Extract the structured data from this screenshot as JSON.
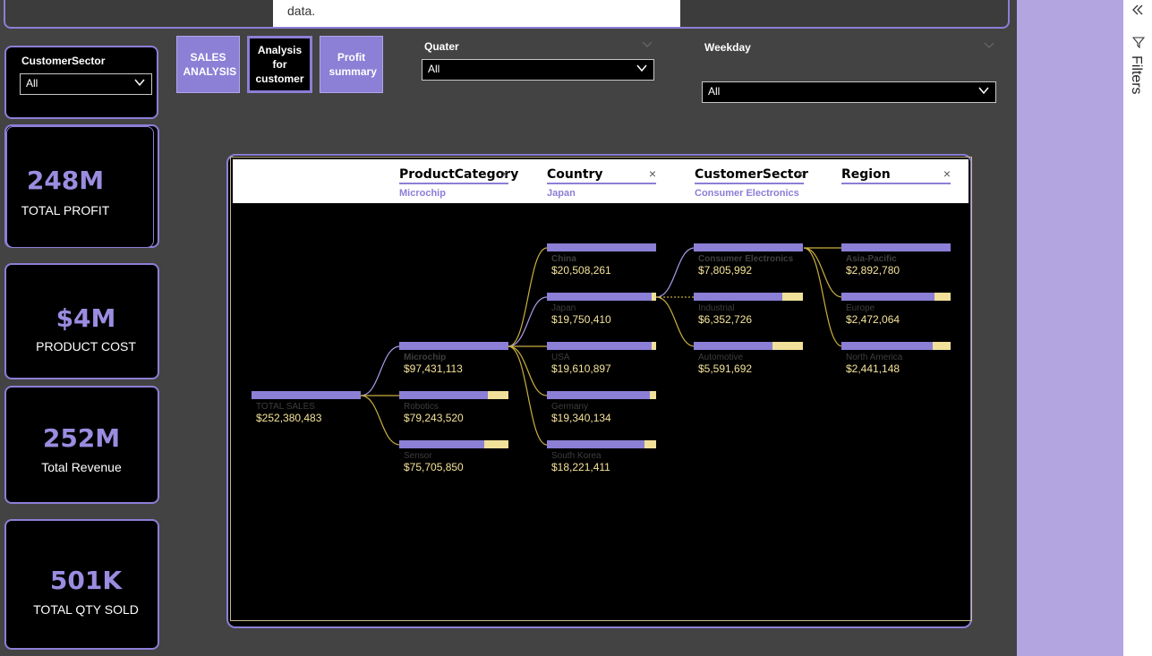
{
  "tooltip": {
    "text": "data."
  },
  "slicers": {
    "customer_sector": {
      "title": "CustomerSector",
      "value": "All"
    },
    "quarter": {
      "title": "Quater",
      "value": "All"
    },
    "weekday": {
      "title": "Weekday",
      "value": "All"
    }
  },
  "nav": {
    "sales": "SALES ANALYSIS",
    "customer": "Analysis for customer",
    "profit": "Profit summary"
  },
  "kpis": [
    {
      "value": "248M",
      "label": "TOTAL PROFIT"
    },
    {
      "value": "$4M",
      "label": "PRODUCT COST"
    },
    {
      "value": "252M",
      "label": "Total Revenue"
    },
    {
      "value": "501K",
      "label": "TOTAL QTY SOLD"
    }
  ],
  "tree": {
    "levels": [
      {
        "title": "ProductCategory",
        "selected": "Microchip",
        "close": "×"
      },
      {
        "title": "Country",
        "selected": "Japan",
        "close": "×"
      },
      {
        "title": "CustomerSector",
        "selected": "Consumer Electronics",
        "close": "×"
      },
      {
        "title": "Region",
        "selected": "",
        "close": "×"
      }
    ],
    "root": {
      "label": "TOTAL SALES",
      "value": "$252,380,483",
      "fill": 1.0
    },
    "product_category": [
      {
        "label": "Microchip",
        "value": "$97,431,113",
        "fill": 1.0
      },
      {
        "label": "Robotics",
        "value": "$79,243,520",
        "fill": 0.81
      },
      {
        "label": "Sensor",
        "value": "$75,705,850",
        "fill": 0.78
      }
    ],
    "country": [
      {
        "label": "China",
        "value": "$20,508,261",
        "fill": 1.0
      },
      {
        "label": "Japan",
        "value": "$19,750,410",
        "fill": 0.96
      },
      {
        "label": "USA",
        "value": "$19,610,897",
        "fill": 0.96
      },
      {
        "label": "Germany",
        "value": "$19,340,134",
        "fill": 0.94
      },
      {
        "label": "South Korea",
        "value": "$18,221,411",
        "fill": 0.89
      }
    ],
    "customer_sector": [
      {
        "label": "Consumer Electronics",
        "value": "$7,805,992",
        "fill": 1.0
      },
      {
        "label": "Industrial",
        "value": "$6,352,726",
        "fill": 0.81
      },
      {
        "label": "Automotive",
        "value": "$5,591,692",
        "fill": 0.72
      }
    ],
    "region": [
      {
        "label": "Asia-Pacific",
        "value": "$2,892,780",
        "fill": 1.0
      },
      {
        "label": "Europe",
        "value": "$2,472,064",
        "fill": 0.85
      },
      {
        "label": "North America",
        "value": "$2,441,148",
        "fill": 0.84
      }
    ]
  },
  "filters_pane": {
    "label": "Filters"
  },
  "colors": {
    "accent": "#8b7fd6",
    "bar_remainder": "#f0e09a",
    "value_text": "#f5e39a",
    "link_line": "#c9b040"
  }
}
